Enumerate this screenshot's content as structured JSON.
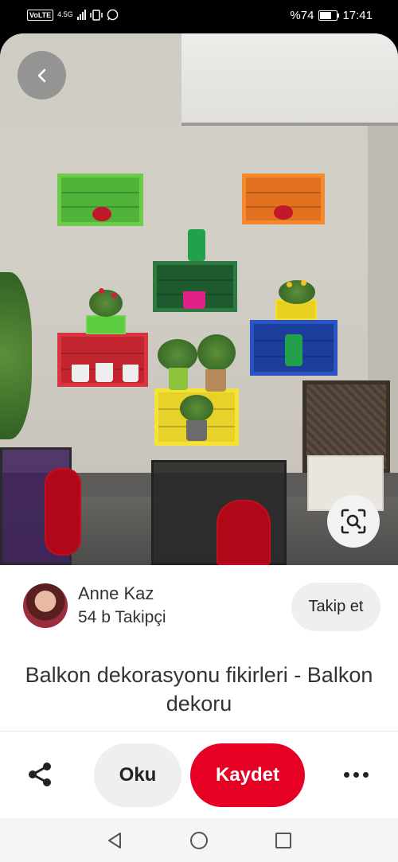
{
  "status_bar": {
    "volte": "VoLTE",
    "network": "4.5G",
    "battery_percent": "%74",
    "battery_level": 0.74,
    "time": "17:41"
  },
  "photo": {
    "back_icon": "chevron-left-icon",
    "lens_icon": "visual-search-icon"
  },
  "author": {
    "name": "Anne Kaz",
    "followers": "54 b Takipçi",
    "follow_label": "Takip et"
  },
  "pin": {
    "title": "Balkon dekorasyonu fikirleri - Balkon dekoru"
  },
  "actions": {
    "share_icon": "share-icon",
    "read_label": "Oku",
    "save_label": "Kaydet",
    "more_icon": "more-dots-icon"
  },
  "nav": {
    "back_icon": "nav-back-triangle-icon",
    "home_icon": "nav-home-circle-icon",
    "recents_icon": "nav-recents-square-icon"
  },
  "colors": {
    "save": "#e60023",
    "secondary_button": "#efefef"
  }
}
